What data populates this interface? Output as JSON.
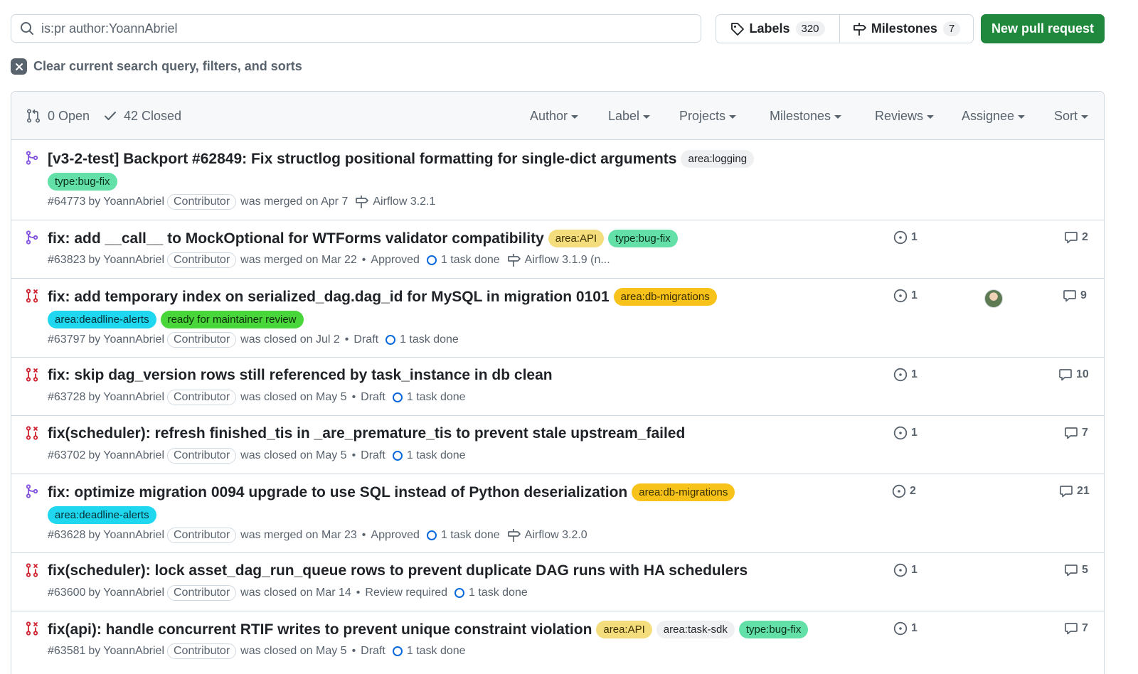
{
  "search": {
    "query": "is:pr author:YoannAbriel"
  },
  "toolbar": {
    "labels_label": "Labels",
    "labels_count": "320",
    "milestones_label": "Milestones",
    "milestones_count": "7",
    "new_pr_label": "New pull request"
  },
  "clear_text": "Clear current search query, filters, and sorts",
  "header": {
    "open_label": "0 Open",
    "closed_label": "42 Closed",
    "filters": [
      "Author",
      "Label",
      "Projects",
      "Milestones",
      "Reviews",
      "Assignee",
      "Sort"
    ]
  },
  "rows": [
    {
      "state": "merged",
      "title": "[v3-2-test] Backport #62849: Fix structlog positional formatting for single-dict arguments",
      "labels_inline": [
        {
          "name": "area:logging",
          "color": "#eef0f2"
        }
      ],
      "labels_wrap": [
        {
          "name": "type:bug-fix",
          "color": "#62e0a8"
        }
      ],
      "number": "#64773",
      "by": "by",
      "author": "YoannAbriel",
      "badge": "Contributor",
      "status": "was merged on Apr 7",
      "review": "",
      "tasks": "",
      "milestone": "Airflow 3.2.1",
      "issues": "",
      "comments": "",
      "has_avatar": false
    },
    {
      "state": "merged",
      "title": "fix: add __call__ to MockOptional for WTForms validator compatibility",
      "labels_inline": [
        {
          "name": "area:API",
          "color": "#f4dd7c"
        },
        {
          "name": "type:bug-fix",
          "color": "#62e0a8"
        }
      ],
      "labels_wrap": [],
      "number": "#63823",
      "by": "by",
      "author": "YoannAbriel",
      "badge": "Contributor",
      "status": "was merged on Mar 22",
      "review": "Approved",
      "tasks": "1 task done",
      "milestone": "Airflow 3.1.9 (n...",
      "issues": "1",
      "comments": "2",
      "has_avatar": false
    },
    {
      "state": "closed",
      "title": "fix: add temporary index on serialized_dag.dag_id for MySQL in migration 0101",
      "labels_inline": [
        {
          "name": "area:db-migrations",
          "color": "#f7c31b"
        }
      ],
      "labels_wrap": [
        {
          "name": "area:deadline-alerts",
          "color": "#1fd8f0"
        },
        {
          "name": "ready for maintainer review",
          "color": "#49d63a"
        }
      ],
      "number": "#63797",
      "by": "by",
      "author": "YoannAbriel",
      "badge": "Contributor",
      "status": "was closed on Jul 2",
      "review": "Draft",
      "tasks": "1 task done",
      "milestone": "",
      "issues": "1",
      "comments": "9",
      "has_avatar": true
    },
    {
      "state": "closed",
      "title": "fix: skip dag_version rows still referenced by task_instance in db clean",
      "labels_inline": [],
      "labels_wrap": [],
      "number": "#63728",
      "by": "by",
      "author": "YoannAbriel",
      "badge": "Contributor",
      "status": "was closed on May 5",
      "review": "Draft",
      "tasks": "1 task done",
      "milestone": "",
      "issues": "1",
      "comments": "10",
      "has_avatar": false
    },
    {
      "state": "closed",
      "title": "fix(scheduler): refresh finished_tis in _are_premature_tis to prevent stale upstream_failed",
      "labels_inline": [],
      "labels_wrap": [],
      "number": "#63702",
      "by": "by",
      "author": "YoannAbriel",
      "badge": "Contributor",
      "status": "was closed on May 5",
      "review": "Draft",
      "tasks": "1 task done",
      "milestone": "",
      "issues": "1",
      "comments": "7",
      "has_avatar": false
    },
    {
      "state": "merged",
      "title": "fix: optimize migration 0094 upgrade to use SQL instead of Python deserialization",
      "labels_inline": [
        {
          "name": "area:db-migrations",
          "color": "#f7c31b"
        }
      ],
      "labels_wrap": [
        {
          "name": "area:deadline-alerts",
          "color": "#1fd8f0"
        }
      ],
      "number": "#63628",
      "by": "by",
      "author": "YoannAbriel",
      "badge": "Contributor",
      "status": "was merged on Mar 23",
      "review": "Approved",
      "tasks": "1 task done",
      "milestone": "Airflow 3.2.0",
      "issues": "2",
      "comments": "21",
      "has_avatar": false
    },
    {
      "state": "closed",
      "title": "fix(scheduler): lock asset_dag_run_queue rows to prevent duplicate DAG runs with HA schedulers",
      "labels_inline": [],
      "labels_wrap": [],
      "number": "#63600",
      "by": "by",
      "author": "YoannAbriel",
      "badge": "Contributor",
      "status": "was closed on Mar 14",
      "review": "Review required",
      "tasks": "1 task done",
      "milestone": "",
      "issues": "1",
      "comments": "5",
      "has_avatar": false
    },
    {
      "state": "closed",
      "title": "fix(api): handle concurrent RTIF writes to prevent unique constraint violation",
      "labels_inline": [
        {
          "name": "area:API",
          "color": "#f4dd7c"
        },
        {
          "name": "area:task-sdk",
          "color": "#eef0f2"
        },
        {
          "name": "type:bug-fix",
          "color": "#62e0a8"
        }
      ],
      "labels_wrap": [],
      "number": "#63581",
      "by": "by",
      "author": "YoannAbriel",
      "badge": "Contributor",
      "status": "was closed on May 5",
      "review": "Draft",
      "tasks": "1 task done",
      "milestone": "",
      "issues": "1",
      "comments": "7",
      "has_avatar": false
    }
  ]
}
